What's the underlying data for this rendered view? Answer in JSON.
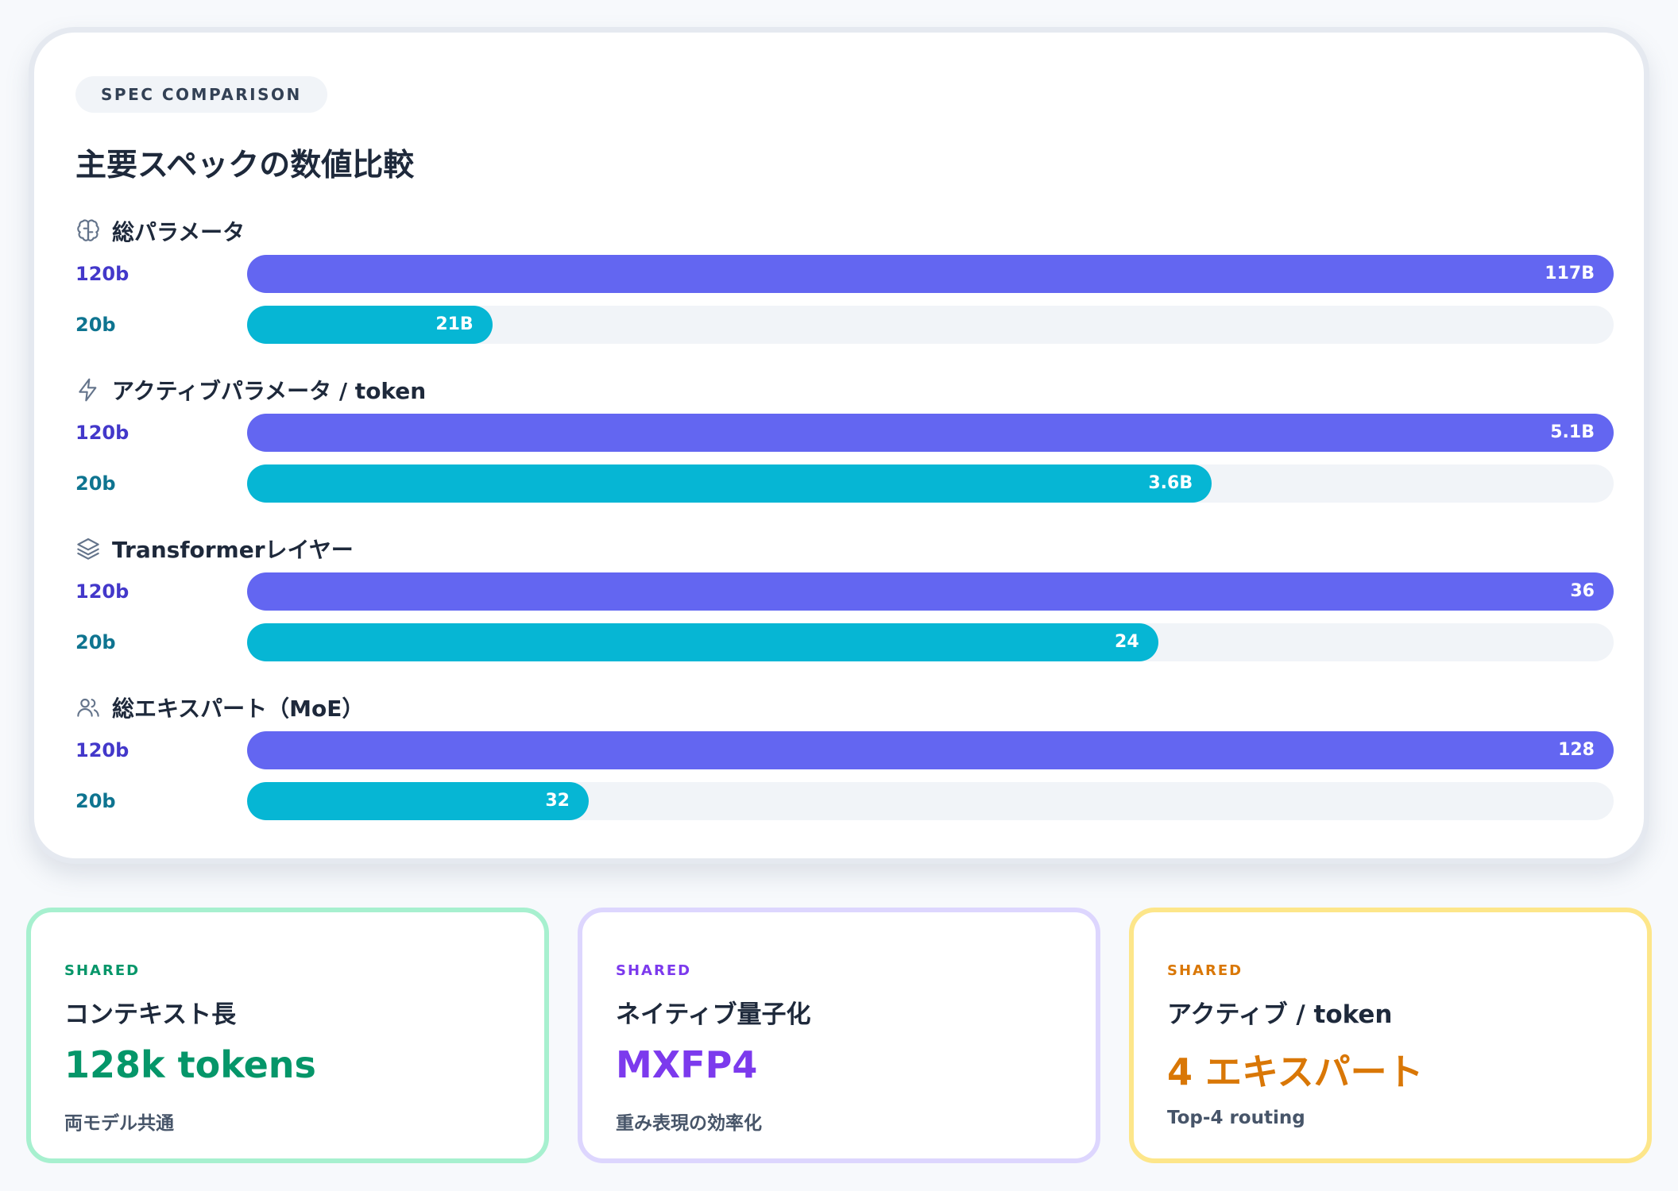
{
  "badge": "SPEC COMPARISON",
  "title": "主要スペックの数値比較",
  "chart_data": {
    "type": "bar",
    "orientation": "horizontal",
    "series_labels": [
      "120b",
      "20b"
    ],
    "colors": {
      "120b": "#6366f1",
      "20b": "#06b6d4",
      "track": "#f1f4f8"
    },
    "groups": [
      {
        "icon": "brain-icon",
        "label": "総パラメータ",
        "values": [
          117,
          21
        ],
        "value_labels": [
          "117B",
          "21B"
        ],
        "max": 117
      },
      {
        "icon": "lightning-icon",
        "label": "アクティブパラメータ / token",
        "values": [
          5.1,
          3.6
        ],
        "value_labels": [
          "5.1B",
          "3.6B"
        ],
        "max": 5.1
      },
      {
        "icon": "layers-icon",
        "label": "Transformerレイヤー",
        "values": [
          36,
          24
        ],
        "value_labels": [
          "36",
          "24"
        ],
        "max": 36
      },
      {
        "icon": "users-icon",
        "label": "総エキスパート（MoE）",
        "values": [
          128,
          32
        ],
        "value_labels": [
          "128",
          "32"
        ],
        "max": 128
      }
    ]
  },
  "cards": [
    {
      "tag": "SHARED",
      "title": "コンテキスト長",
      "value": "128k tokens",
      "note": "両モデル共通",
      "color": "#059669"
    },
    {
      "tag": "SHARED",
      "title": "ネイティブ量子化",
      "value": "MXFP4",
      "note": "重み表現の効率化",
      "color": "#7c3aed"
    },
    {
      "tag": "SHARED",
      "title": "アクティブ / token",
      "value": "4 エキスパート",
      "note": "Top-4 routing",
      "color": "#d97706"
    }
  ]
}
